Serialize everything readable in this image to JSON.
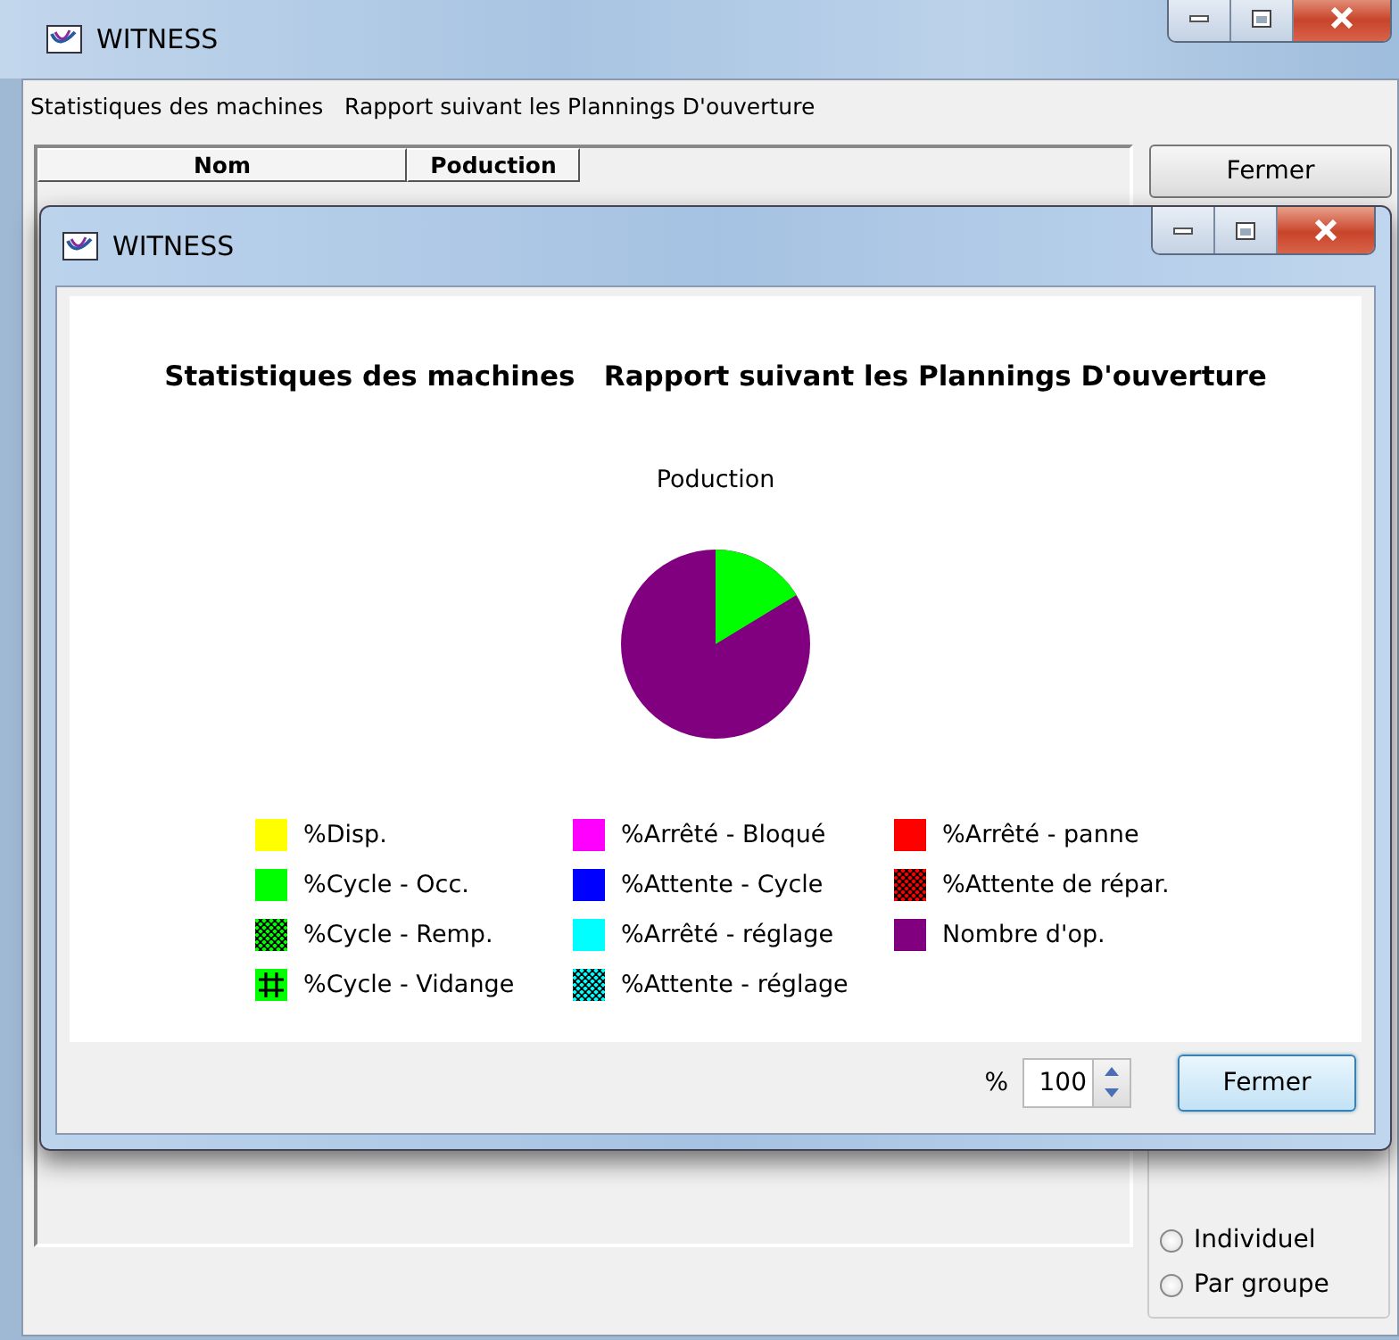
{
  "main_window": {
    "title": "WITNESS",
    "subtitle": "Statistiques des machines   Rapport suivant les Plannings D'ouverture",
    "table": {
      "columns": [
        "Nom",
        "Poduction"
      ]
    },
    "close_button": "Fermer",
    "radios": [
      {
        "label": "Individuel",
        "selected": false
      },
      {
        "label": "Par groupe",
        "selected": false
      }
    ]
  },
  "dialog": {
    "title": "WITNESS",
    "heading": "Statistiques des machines   Rapport suivant les Plannings D'ouverture",
    "chart_title": "Poduction",
    "legend": [
      {
        "label": "%Disp.",
        "color": "#ffff00",
        "kind": "solid"
      },
      {
        "label": "%Cycle - Occ.",
        "color": "#00ff00",
        "kind": "solid"
      },
      {
        "label": "%Cycle - Remp.",
        "color": "#00ff00",
        "kind": "crosshatch"
      },
      {
        "label": "%Cycle - Vidange",
        "color": "#00ff00",
        "kind": "grid"
      },
      {
        "label": "%Arrêté - Bloqué",
        "color": "#ff00ff",
        "kind": "solid"
      },
      {
        "label": "%Attente - Cycle",
        "color": "#0000ff",
        "kind": "solid"
      },
      {
        "label": "%Arrêté - réglage",
        "color": "#00ffff",
        "kind": "solid"
      },
      {
        "label": "%Attente - réglage",
        "color": "#00ffff",
        "kind": "crosshatch"
      },
      {
        "label": "%Arrêté - panne",
        "color": "#ff0000",
        "kind": "solid"
      },
      {
        "label": "%Attente de répar.",
        "color": "#ff0000",
        "kind": "crosshatch"
      },
      {
        "label": "Nombre d'op.",
        "color": "#800080",
        "kind": "solid"
      }
    ],
    "zoom": {
      "label": "%",
      "value": "100"
    },
    "close_button": "Fermer"
  }
}
